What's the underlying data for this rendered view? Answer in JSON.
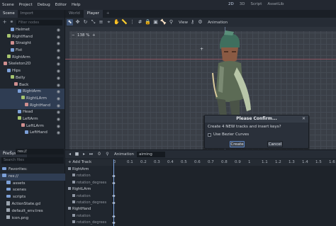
{
  "menu": [
    "Scene",
    "Project",
    "Debug",
    "Editor",
    "Help"
  ],
  "workspaces": [
    "2D",
    "3D",
    "Script",
    "AssetLib"
  ],
  "scene_dock": {
    "tabs": [
      "Scene",
      "Import"
    ],
    "filter_placeholder": "Filter nodes",
    "nodes": [
      {
        "label": "Helmet",
        "indent": 3
      },
      {
        "label": "RightHand",
        "indent": 2
      },
      {
        "label": "Straight",
        "indent": 3
      },
      {
        "label": "Fist",
        "indent": 3
      },
      {
        "label": "RightArm",
        "indent": 2
      },
      {
        "label": "Skeleton2D",
        "indent": 1
      },
      {
        "label": "Hips",
        "indent": 2
      },
      {
        "label": "Belly",
        "indent": 3
      },
      {
        "label": "Back",
        "indent": 4
      },
      {
        "label": "RightArm",
        "indent": 5,
        "selected": true
      },
      {
        "label": "RightLArm",
        "indent": 6,
        "selected": true
      },
      {
        "label": "RightHand",
        "indent": 7,
        "selected": true
      },
      {
        "label": "Head",
        "indent": 5
      },
      {
        "label": "LeftArm",
        "indent": 5
      },
      {
        "label": "LeftLArm",
        "indent": 6
      },
      {
        "label": "LeftHand",
        "indent": 7
      }
    ]
  },
  "filesystem": {
    "tab": "FileSystem",
    "path": "res://",
    "search_placeholder": "Search files",
    "items": [
      {
        "label": "Favorites:",
        "type": "folder",
        "indent": 1,
        "selected": false
      },
      {
        "label": "res://",
        "type": "folder",
        "indent": 1,
        "selected": true
      },
      {
        "label": "assets",
        "type": "folder",
        "indent": 3,
        "selected": false
      },
      {
        "label": "scenes",
        "type": "folder",
        "indent": 3,
        "selected": false
      },
      {
        "label": "scripts",
        "type": "folder",
        "indent": 3,
        "selected": false
      },
      {
        "label": "ActionState.gd",
        "type": "file",
        "indent": 3,
        "selected": false
      },
      {
        "label": "default_env.tres",
        "type": "file",
        "indent": 3,
        "selected": false
      },
      {
        "label": "icon.png",
        "type": "file",
        "indent": 3,
        "selected": false
      }
    ]
  },
  "editor": {
    "scene_tabs": [
      "World",
      "Player"
    ],
    "active_tab": "Player",
    "view_label": "View",
    "animation_label": "Animation",
    "zoom": "138 %"
  },
  "dialog": {
    "title": "Please Confirm...",
    "message": "Create 4 NEW tracks and insert keys?",
    "checkbox_label": "Use Bezier Curves",
    "create_label": "Create",
    "cancel_label": "Cancel"
  },
  "animation": {
    "label": "Animation",
    "current": "aiming",
    "add_track": "+ Add Track",
    "timeline_numbers": [
      "0",
      "0.1",
      "0.2",
      "0.3",
      "0.4",
      "0.5",
      "0.6",
      "0.7",
      "0.8",
      "0.9",
      "1",
      "1.1",
      "1.2",
      "1.3",
      "1.4",
      "1.5",
      "1.6"
    ],
    "tracks": [
      {
        "label": "RightArm",
        "kind": "group"
      },
      {
        "label": "rotation",
        "kind": "property"
      },
      {
        "label": "rotation_degrees",
        "kind": "property"
      },
      {
        "label": "RightLArm",
        "kind": "group"
      },
      {
        "label": "rotation",
        "kind": "property"
      },
      {
        "label": "rotation_degrees",
        "kind": "property"
      },
      {
        "label": "RightHand",
        "kind": "group"
      },
      {
        "label": "rotation",
        "kind": "property"
      },
      {
        "label": "rotation_degrees",
        "kind": "property"
      }
    ]
  },
  "colors": {
    "accent": "#5b84c4",
    "selection": "#2f3d53",
    "panel": "#20262e"
  }
}
